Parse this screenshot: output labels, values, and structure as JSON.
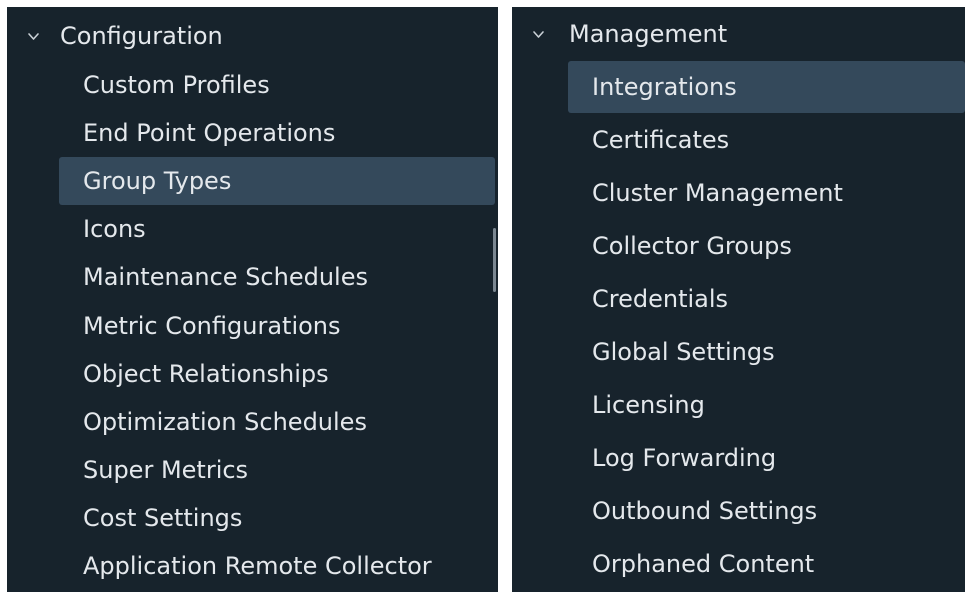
{
  "left_panel": {
    "section_title": "Configuration",
    "items": [
      {
        "label": "Custom Profiles",
        "selected": false
      },
      {
        "label": "End Point Operations",
        "selected": false
      },
      {
        "label": "Group Types",
        "selected": true
      },
      {
        "label": "Icons",
        "selected": false
      },
      {
        "label": "Maintenance Schedules",
        "selected": false
      },
      {
        "label": "Metric Configurations",
        "selected": false
      },
      {
        "label": "Object Relationships",
        "selected": false
      },
      {
        "label": "Optimization Schedules",
        "selected": false
      },
      {
        "label": "Super Metrics",
        "selected": false
      },
      {
        "label": "Cost Settings",
        "selected": false
      },
      {
        "label": "Application Remote Collector",
        "selected": false
      }
    ]
  },
  "right_panel": {
    "section_title": "Management",
    "items": [
      {
        "label": "Integrations",
        "selected": true
      },
      {
        "label": "Certificates",
        "selected": false
      },
      {
        "label": "Cluster Management",
        "selected": false
      },
      {
        "label": "Collector Groups",
        "selected": false
      },
      {
        "label": "Credentials",
        "selected": false
      },
      {
        "label": "Global Settings",
        "selected": false
      },
      {
        "label": "Licensing",
        "selected": false
      },
      {
        "label": "Log Forwarding",
        "selected": false
      },
      {
        "label": "Outbound Settings",
        "selected": false
      },
      {
        "label": "Orphaned Content",
        "selected": false
      }
    ]
  },
  "icons": {
    "section_toggle": "chevron-down-icon"
  },
  "colors": {
    "panel_background": "#17232c",
    "selected_background": "#34495b",
    "text": "#e4e8ec",
    "scrollbar": "#7b8791"
  }
}
